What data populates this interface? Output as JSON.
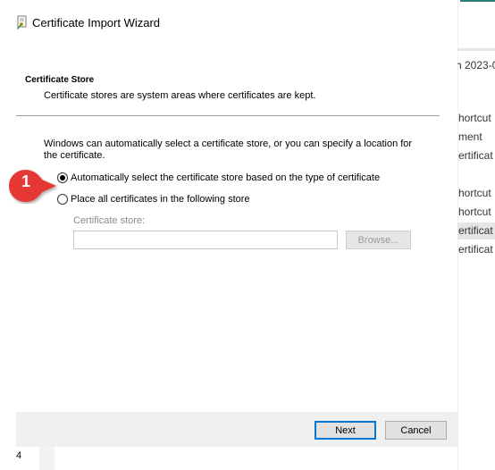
{
  "window": {
    "title": "Certificate Import Wizard"
  },
  "section": {
    "title": "Certificate Store",
    "description": "Certificate stores are system areas where certificates are kept."
  },
  "intro_text": "Windows can automatically select a certificate store, or you can specify a location for the certificate.",
  "options": {
    "auto_label": "Automatically select the certificate store based on the type of certificate",
    "auto_checked": true,
    "manual_label": "Place all certificates in the following store",
    "manual_checked": false
  },
  "store": {
    "label": "Certificate store:",
    "value": "",
    "browse_label": "Browse..."
  },
  "buttons": {
    "next_label": "Next",
    "cancel_label": "Cancel"
  },
  "annotation": {
    "step_number": "1",
    "color": "#e53935"
  },
  "page_number": "4",
  "background_list": {
    "items": [
      "h 2023-0",
      "hortcut",
      "ment",
      "ertificat",
      "hortcut",
      "hortcut",
      "ertificat",
      "ertificat"
    ]
  },
  "colors": {
    "accent": "#0078d7",
    "footer_bg": "#f0f0f0"
  }
}
